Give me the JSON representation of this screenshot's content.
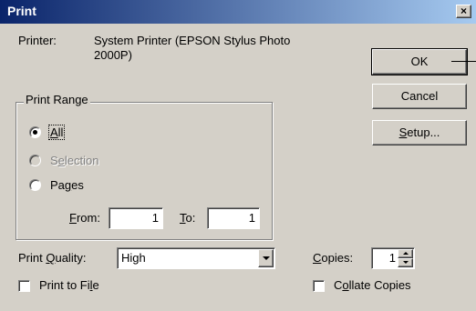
{
  "window": {
    "title": "Print",
    "close_glyph": "×"
  },
  "printer": {
    "label": "Printer:",
    "name_line1": "System Printer (EPSON Stylus Photo",
    "name_line2": "2000P)"
  },
  "buttons": {
    "ok": "OK",
    "cancel": "Cancel",
    "setup_prefix": "S",
    "setup_rest": "etup..."
  },
  "print_range": {
    "label": "Print Range",
    "all": {
      "mn": "A",
      "rest": "ll",
      "selected": true
    },
    "selection": {
      "pre": "S",
      "mn": "e",
      "rest": "lection",
      "enabled": false
    },
    "pages": {
      "pre": "Pa",
      "mn": "g",
      "rest": "es"
    },
    "from_label_mn": "F",
    "from_label_rest": "rom:",
    "from_value": "1",
    "to_label_mn": "T",
    "to_label_rest": "o:",
    "to_value": "1"
  },
  "quality": {
    "label_pre": "Print ",
    "label_mn": "Q",
    "label_rest": "uality:",
    "value": "High"
  },
  "copies": {
    "label_mn": "C",
    "label_rest": "opies:",
    "value": "1"
  },
  "print_to_file": {
    "pre": "Print to Fi",
    "mn": "l",
    "rest": "e",
    "checked": false
  },
  "collate": {
    "pre": "C",
    "mn": "o",
    "rest": "llate Copies",
    "checked": false
  }
}
